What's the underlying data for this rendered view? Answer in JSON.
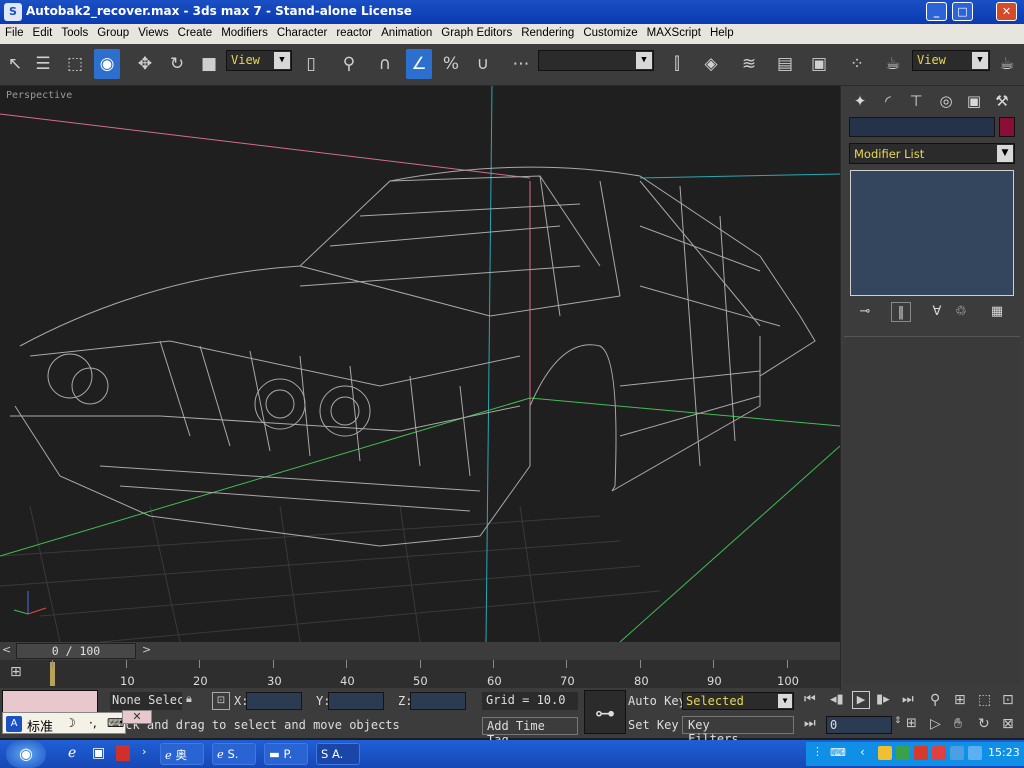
{
  "window": {
    "title": "Autobak2_recover.max - 3ds max 7 - Stand-alone License",
    "controls": [
      "_",
      "□",
      "✕"
    ]
  },
  "menu": [
    "File",
    "Edit",
    "Tools",
    "Group",
    "Views",
    "Create",
    "Modifiers",
    "Character",
    "reactor",
    "Animation",
    "Graph Editors",
    "Rendering",
    "Customize",
    "MAXScript",
    "Help"
  ],
  "toolbar": {
    "reference_coord": "View",
    "named_selection": "",
    "render_view": "View"
  },
  "viewport": {
    "label": "Perspective"
  },
  "command_panel": {
    "modifier_list": "Modifier List",
    "object_name": "",
    "object_color": "#8a0f36"
  },
  "time": {
    "slider": "0 / 100",
    "ticks": [
      "10",
      "20",
      "30",
      "40",
      "50",
      "60",
      "70",
      "80",
      "90",
      "100"
    ]
  },
  "status": {
    "selection": "None Selec",
    "prompt": "ick and drag to select and move objects",
    "x_label": "X:",
    "y_label": "Y:",
    "z_label": "Z:",
    "grid": "Grid = 10.0",
    "add_time_tag": "Add Time Tag",
    "auto_key": "Auto Key",
    "set_key": "Set Key",
    "selected": "Selected",
    "key_filters": "Key Filters...",
    "frame": "0"
  },
  "ime": {
    "text": "标准"
  },
  "taskbar": {
    "items": [
      "奥",
      "S.",
      "P.",
      "A."
    ],
    "clock": "15:23"
  }
}
